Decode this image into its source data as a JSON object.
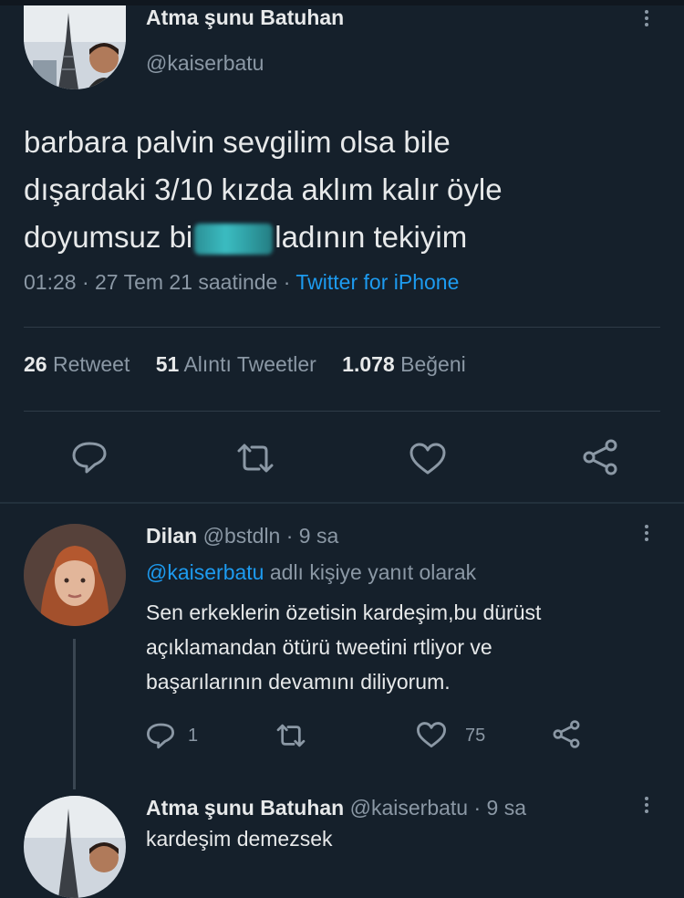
{
  "main_tweet": {
    "author_name": "Atma şunu Batuhan",
    "author_handle": "@kaiserbatu",
    "text_lines": [
      "barbara palvin sevgilim olsa bile",
      "dışardaki 3/10 kızda aklım kalır öyle",
      "ladının tekiyim"
    ],
    "text_line3_prefix": "doyumsuz bi",
    "time": "01:28",
    "date_text": "27 Tem 21 saatinde",
    "separator": "·",
    "source": "Twitter for iPhone",
    "stats": {
      "retweets": "26",
      "retweets_label": "Retweet",
      "quotes": "51",
      "quotes_label": "Alıntı Tweetler",
      "likes": "1.078",
      "likes_label": "Beğeni"
    },
    "actions": [
      "reply-icon",
      "retweet-icon",
      "like-icon",
      "share-icon"
    ]
  },
  "replies": [
    {
      "author_name": "Dilan",
      "author_handle": "@bstdln",
      "time_ago": "· 9 sa",
      "reply_to_mention": "@kaiserbatu",
      "reply_to_suffix": "adlı kişiye yanıt olarak",
      "text_lines": [
        "Sen erkeklerin özetisin kardeşim,bu dürüst",
        "açıklamandan ötürü tweetini rtliyor ve",
        "başarılarının devamını diliyorum."
      ],
      "reply_count": "1",
      "like_count": "75"
    },
    {
      "author_name": "Atma şunu Batuhan",
      "author_handle": "@kaiserbatu",
      "time_ago": "· 9 sa",
      "text": "kardeşim demezsek"
    }
  ],
  "colors": {
    "background": "#15202b",
    "text": "#e7e9ea",
    "secondary": "#8b98a5",
    "link": "#1d9bf0"
  }
}
